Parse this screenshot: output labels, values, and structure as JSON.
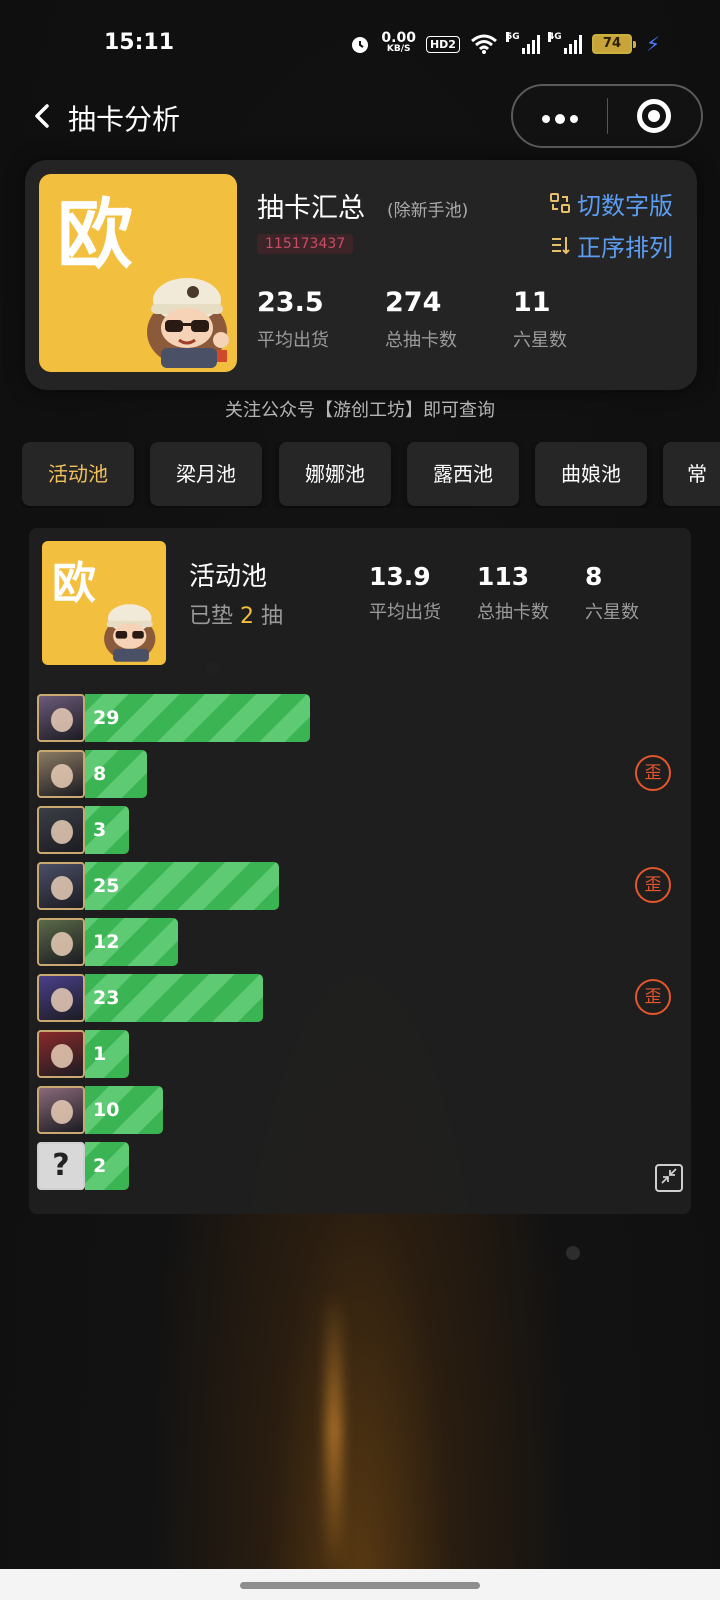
{
  "status_bar": {
    "time": "15:11",
    "net_speed_value": "0.00",
    "net_speed_unit": "KB/S",
    "hd_label": "HD2",
    "sim1_label": "5G",
    "sim2_label": "4G",
    "battery": "74"
  },
  "nav": {
    "title": "抽卡分析",
    "more_icon": "more-dots-icon",
    "close_icon": "target-circle-icon"
  },
  "summary": {
    "avatar_badge": "欧",
    "title": "抽卡汇总",
    "subtitle": "(除新手池)",
    "uid": "115173437",
    "stats": [
      {
        "value": "23.5",
        "label": "平均出货"
      },
      {
        "value": "274",
        "label": "总抽卡数"
      },
      {
        "value": "11",
        "label": "六星数"
      }
    ],
    "actions": [
      {
        "label": "切数字版",
        "icon": "swap-icon"
      },
      {
        "label": "正序排列",
        "icon": "sort-icon"
      }
    ]
  },
  "follow_hint": "关注公众号【游创工坊】即可查询",
  "tabs": [
    {
      "label": "活动池",
      "active": true
    },
    {
      "label": "梁月池",
      "active": false
    },
    {
      "label": "娜娜池",
      "active": false
    },
    {
      "label": "露西池",
      "active": false
    },
    {
      "label": "曲娘池",
      "active": false
    },
    {
      "label": "常",
      "active": false
    }
  ],
  "pool": {
    "avatar_badge": "欧",
    "name": "活动池",
    "pity_prefix": "已垫",
    "pity_count": "2",
    "pity_suffix": "抽",
    "stats": [
      {
        "value": "13.9",
        "label": "平均出货"
      },
      {
        "value": "113",
        "label": "总抽卡数"
      },
      {
        "value": "8",
        "label": "六星数"
      }
    ],
    "wai_label": "歪",
    "records": [
      {
        "pulls": 29,
        "wai": false,
        "color": "#6b5a7a"
      },
      {
        "pulls": 8,
        "wai": true,
        "color": "#8a7a62"
      },
      {
        "pulls": 3,
        "wai": false,
        "color": "#3a3f45"
      },
      {
        "pulls": 25,
        "wai": true,
        "color": "#4a4f66"
      },
      {
        "pulls": 12,
        "wai": false,
        "color": "#5a6a48"
      },
      {
        "pulls": 23,
        "wai": true,
        "color": "#4a3f8a"
      },
      {
        "pulls": 1,
        "wai": false,
        "color": "#8a2a2a"
      },
      {
        "pulls": 10,
        "wai": false,
        "color": "#8a6a7a"
      },
      {
        "pulls": 2,
        "wai": false,
        "color": "#d8d8d8",
        "unknown": true,
        "unknown_label": "?"
      }
    ]
  }
}
